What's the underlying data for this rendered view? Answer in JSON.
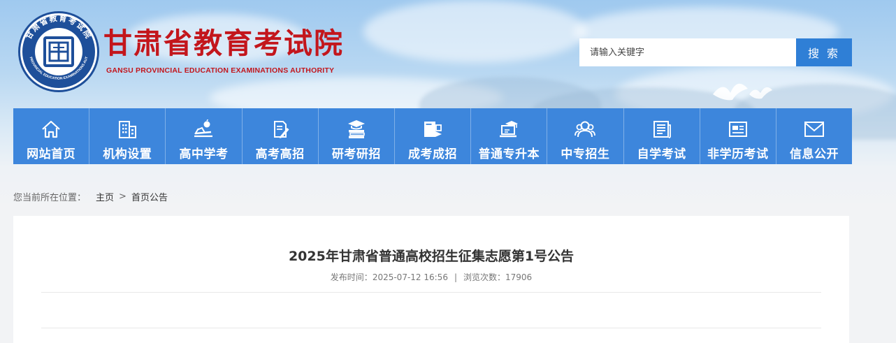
{
  "header": {
    "title": "甘肃省教育考试院",
    "subtitle": "GANSU PROVINCIAL EDUCATION EXAMINATIONS AUTHORITY",
    "logo_ring_text": "甘肃省教育考试院",
    "logo_ring_text_en": "GANSU PROVINCIAL EDUCATION EXAMINATIONS AUTHORITY",
    "brand_color": "#c3161c"
  },
  "search": {
    "placeholder": "请输入关键字",
    "button_label": "搜 索",
    "accent_color": "#2f7fd6"
  },
  "nav": {
    "items": [
      {
        "label": "网站首页",
        "icon": "home-icon"
      },
      {
        "label": "机构设置",
        "icon": "building-icon"
      },
      {
        "label": "高中学考",
        "icon": "books-apple-icon"
      },
      {
        "label": "高考高招",
        "icon": "document-pen-icon"
      },
      {
        "label": "研考研招",
        "icon": "books-graduation-cap-icon"
      },
      {
        "label": "成考成招",
        "icon": "book-pencil-icon"
      },
      {
        "label": "普通专升本",
        "icon": "laptop-graduation-cap-icon"
      },
      {
        "label": "中专招生",
        "icon": "users-icon"
      },
      {
        "label": "自学考试",
        "icon": "newspaper-icon"
      },
      {
        "label": "非学历考试",
        "icon": "id-card-icon"
      },
      {
        "label": "信息公开",
        "icon": "mail-icon"
      }
    ],
    "background_color": "#3d86dc"
  },
  "breadcrumb": {
    "prefix": "您当前所在位置：",
    "home": "主页",
    "separator": ">",
    "current": "首页公告"
  },
  "article": {
    "title": "2025年甘肃省普通高校招生征集志愿第1号公告",
    "publish_label": "发布时间：",
    "publish_time": "2025-07-12 16:56",
    "divider": "|",
    "views_label": "浏览次数：",
    "views": "17906"
  }
}
